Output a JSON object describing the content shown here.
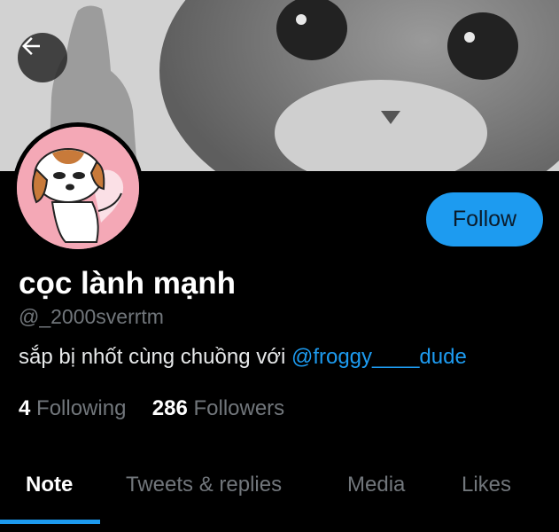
{
  "profile": {
    "display_name": "cọc lành mạnh",
    "handle": "@_2000sverrtm",
    "bio_text": "sắp bị nhốt cùng chuồng với ",
    "bio_mention": "@froggy____dude",
    "following_count": "4",
    "following_label": "Following",
    "followers_count": "286",
    "followers_label": "Followers"
  },
  "actions": {
    "follow_label": "Follow"
  },
  "tabs": [
    {
      "label": "Note",
      "active": true
    },
    {
      "label": "Tweets & replies",
      "active": false
    },
    {
      "label": "Media",
      "active": false
    },
    {
      "label": "Likes",
      "active": false
    }
  ],
  "colors": {
    "accent": "#1d9bf0",
    "background": "#000000",
    "secondary_text": "#71767b"
  },
  "icons": {
    "back": "arrow-left-icon"
  }
}
